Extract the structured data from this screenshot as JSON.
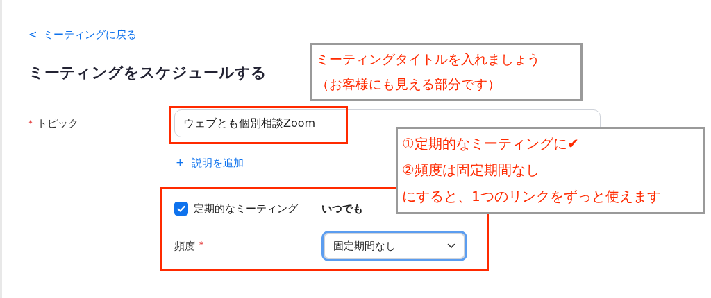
{
  "back_link": {
    "icon": "<",
    "label": "ミーティングに戻る"
  },
  "heading": "ミーティングをスケジュールする",
  "topic": {
    "required_mark": "*",
    "label": "トピック",
    "value": "ウェブとも個別相談Zoom"
  },
  "add_description": {
    "icon": "+",
    "label": "説明を追加"
  },
  "recurring": {
    "label": "定期的なミーティング",
    "checked": true,
    "note": "いつでも"
  },
  "frequency": {
    "label": "頻度",
    "required_mark": "*",
    "value": "固定期間なし"
  },
  "annotations": [
    {
      "lines": [
        "ミーティングタイトルを入れましょう",
        "（お客様にも見える部分です）"
      ]
    },
    {
      "lines": [
        "①定期的なミーティングに✔",
        "②頻度は固定期間なし",
        "にすると、1つのリンクをずっと使えます"
      ]
    }
  ]
}
